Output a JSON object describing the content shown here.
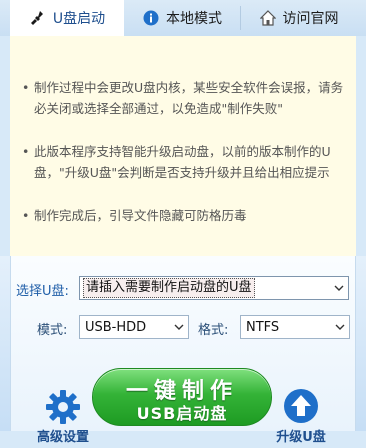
{
  "tabs": [
    {
      "label": "U盘启动",
      "icon": "usb-icon"
    },
    {
      "label": "本地模式",
      "icon": "info-icon"
    },
    {
      "label": "访问官网",
      "icon": "home-icon"
    }
  ],
  "notices": [
    "制作过程中会更改U盘内核，某些安全软件会误报，请务必关闭或选择全部通过，以免造成\"制作失败\"",
    "此版本程序支持智能升级启动盘，以前的版本制作的U盘，\"升级U盘\"会判断是否支持升级并且给出相应提示",
    "制作完成后，引导文件隐藏可防格历毒"
  ],
  "form": {
    "usb_label": "选择U盘:",
    "usb_value": "请插入需要制作启动盘的U盘",
    "mode_label": "模式:",
    "mode_value": "USB-HDD",
    "format_label": "格式:",
    "format_value": "NTFS"
  },
  "actions": {
    "make_line1": "一键制作",
    "make_line2": "USB启动盘",
    "left_label": "高级设置",
    "right_label": "升级U盘"
  },
  "colors": {
    "accent": "#1f5ea8",
    "green": "#2fae34",
    "notice_bg": "#fffce6"
  }
}
